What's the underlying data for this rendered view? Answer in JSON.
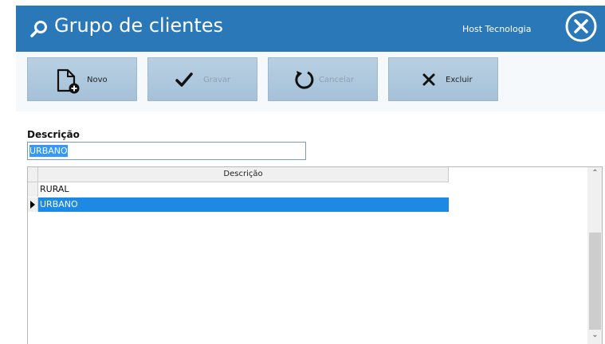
{
  "window": {
    "title": "Grupo de clientes",
    "company": "Host Tecnologia"
  },
  "toolbar": {
    "new_label": "Novo",
    "save_label": "Gravar",
    "cancel_label": "Cancelar",
    "delete_label": "Excluir"
  },
  "form": {
    "description_label": "Descrição",
    "description_value": "URBANO"
  },
  "grid": {
    "column_header": "Descrição",
    "rows": [
      {
        "value": "RURAL",
        "selected": false
      },
      {
        "value": "URBANO",
        "selected": true
      }
    ]
  },
  "colors": {
    "titlebar": "#2b78b8",
    "button": "#b9d0e3",
    "selection": "#1e88e5"
  }
}
